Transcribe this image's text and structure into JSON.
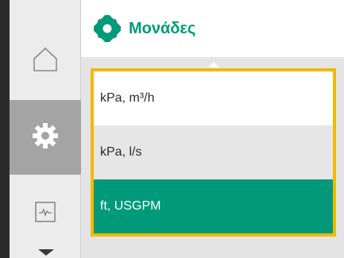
{
  "header": {
    "title": "Μονάδες",
    "icon": "gear-icon",
    "title_color": "#009a7a"
  },
  "sidebar": {
    "items": [
      {
        "icon": "home-icon",
        "active": false
      },
      {
        "icon": "gear-icon",
        "active": true
      },
      {
        "icon": "monitor-icon",
        "active": false
      }
    ]
  },
  "units_list": {
    "options": [
      {
        "label": "kPa, m³/h",
        "selected": false
      },
      {
        "label": "kPa, l/s",
        "selected": false
      },
      {
        "label": "ft, USGPM",
        "selected": true
      }
    ],
    "accent_color": "#f5b800",
    "selected_color": "#009a7a"
  }
}
